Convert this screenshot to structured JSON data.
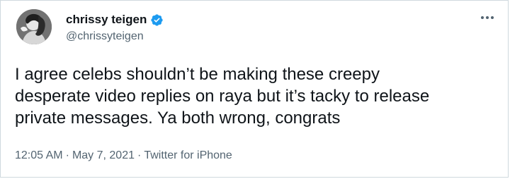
{
  "author": {
    "display_name": "chrissy teigen",
    "handle": "@chrissyteigen",
    "verified": true
  },
  "tweet": {
    "text": "I agree celebs shouldn’t be making these creepy\ndesperate video replies on raya but it’s tacky to release\nprivate messages. Ya both wrong, congrats"
  },
  "meta": {
    "time": "12:05 AM",
    "separator": "·",
    "date": "May 7, 2021",
    "source": "Twitter for iPhone"
  },
  "icons": {
    "verified": "verified-badge-icon",
    "more": "more-options-icon"
  },
  "colors": {
    "accent": "#1d9bf0",
    "text_primary": "#0f1419",
    "text_secondary": "#536471",
    "border": "#cfd9de"
  }
}
